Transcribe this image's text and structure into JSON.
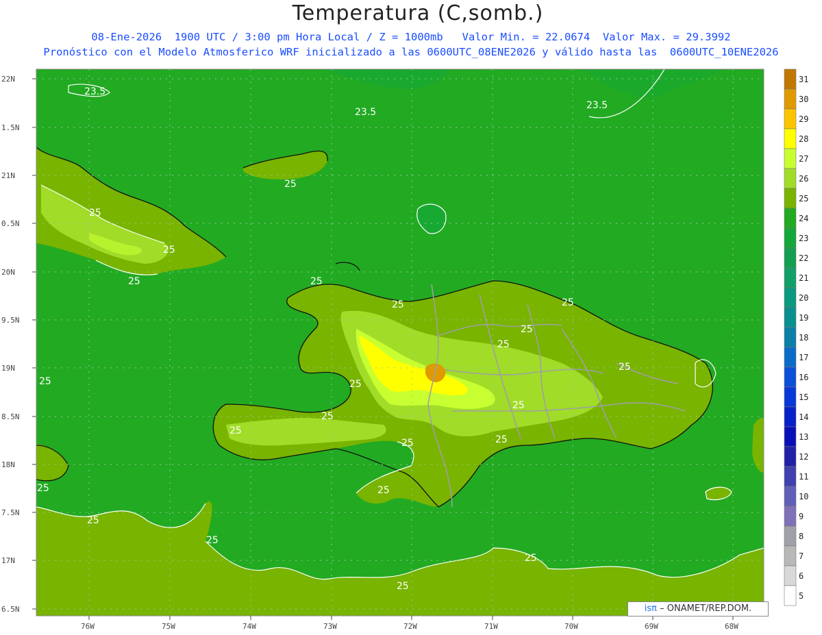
{
  "header": {
    "title": "Temperatura (C,somb.)",
    "line1": "08-Ene-2026  1900 UTC / 3:00 pm Hora Local / Z = 1000mb   Valor Min. = 22.0674  Valor Max. = 29.3992",
    "line2": "Pronóstico con el Modelo Atmosferico WRF inicializado a las 0600UTC_08ENE2026 y válido hasta las  0600UTC_10ENE2026"
  },
  "axes": {
    "lat_labels": [
      "22N",
      "1.5N",
      "21N",
      "0.5N",
      "20N",
      "9.5N",
      "19N",
      "8.5N",
      "18N",
      "7.5N",
      "17N",
      "6.5N"
    ],
    "lon_labels": [
      "76W",
      "75W",
      "74W",
      "73W",
      "72W",
      "71W",
      "70W",
      "69W",
      "68W"
    ]
  },
  "colorbar": {
    "labels": [
      "31",
      "30",
      "29",
      "28",
      "27",
      "26",
      "25",
      "24",
      "23",
      "22",
      "21",
      "20",
      "19",
      "18",
      "17",
      "16",
      "15",
      "14",
      "13",
      "12",
      "11",
      "10",
      "9",
      "8",
      "7",
      "6",
      "5"
    ],
    "colors": [
      "#c07800",
      "#e09a00",
      "#ffc400",
      "#ffff00",
      "#c8ff30",
      "#a0dc28",
      "#78b400",
      "#22aa22",
      "#14a83a",
      "#12a050",
      "#10a068",
      "#0a9a80",
      "#089090",
      "#0a80a8",
      "#0a6cc8",
      "#0a50d8",
      "#0838d8",
      "#0820c8",
      "#0a10b8",
      "#2020a8",
      "#4040b0",
      "#6060b8",
      "#8070b8",
      "#a0a0a8",
      "#b8b8b8",
      "#d8d8d8",
      "#ffffff"
    ]
  },
  "contour_labels": [
    "23.5",
    "23.5",
    "23.5",
    "25",
    "25",
    "25",
    "25",
    "25",
    "25",
    "25",
    "25",
    "25",
    "25",
    "25",
    "25",
    "25",
    "25",
    "25",
    "25",
    "25",
    "25",
    "25",
    "25",
    "25",
    "25",
    "25"
  ],
  "credit": {
    "logo": "isπ",
    "text": "– ONAMET/REP.DOM."
  }
}
